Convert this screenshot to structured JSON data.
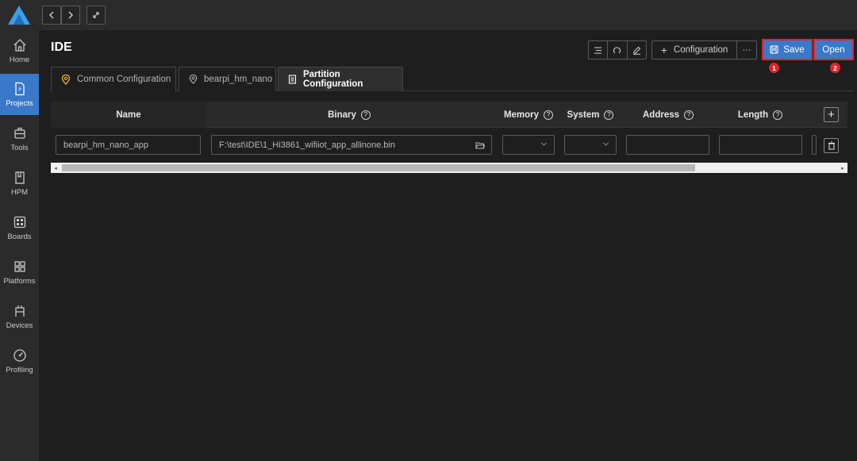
{
  "sidebar": {
    "items": [
      {
        "label": "Home",
        "icon": "home-icon"
      },
      {
        "label": "Projects",
        "icon": "project-file-icon",
        "active": true
      },
      {
        "label": "Tools",
        "icon": "toolbox-icon"
      },
      {
        "label": "HPM",
        "icon": "book-icon"
      },
      {
        "label": "Boards",
        "icon": "board-icon"
      },
      {
        "label": "Platforms",
        "icon": "grid-icon"
      },
      {
        "label": "Devices",
        "icon": "device-icon"
      },
      {
        "label": "Profiling",
        "icon": "gauge-icon"
      }
    ]
  },
  "header": {
    "title": "IDE",
    "configuration_label": "Configuration",
    "more_label": "···",
    "save_label": "Save",
    "open_label": "Open",
    "marker_1": "1",
    "marker_2": "2"
  },
  "tabs": [
    {
      "label": "Common Configuration",
      "icon": "location-pin-icon"
    },
    {
      "label": "bearpi_hm_nano",
      "icon": "location-pin-icon"
    },
    {
      "label": "Partition Configuration",
      "icon": "document-icon",
      "active": true
    }
  ],
  "table": {
    "columns": [
      "Name",
      "Binary",
      "Memory",
      "System",
      "Address",
      "Length"
    ],
    "help_symbol": "?",
    "rows": [
      {
        "name": "bearpi_hm_nano_app",
        "binary": "F:\\test\\IDE\\1_Hi3861_wifiiot_app_allinone.bin",
        "memory": "",
        "system": "",
        "address": "",
        "length": ""
      }
    ]
  },
  "colors": {
    "accent": "#3a78c9",
    "highlight": "#e0242a",
    "background": "#1e1e1e",
    "panel": "#2b2b2b"
  }
}
